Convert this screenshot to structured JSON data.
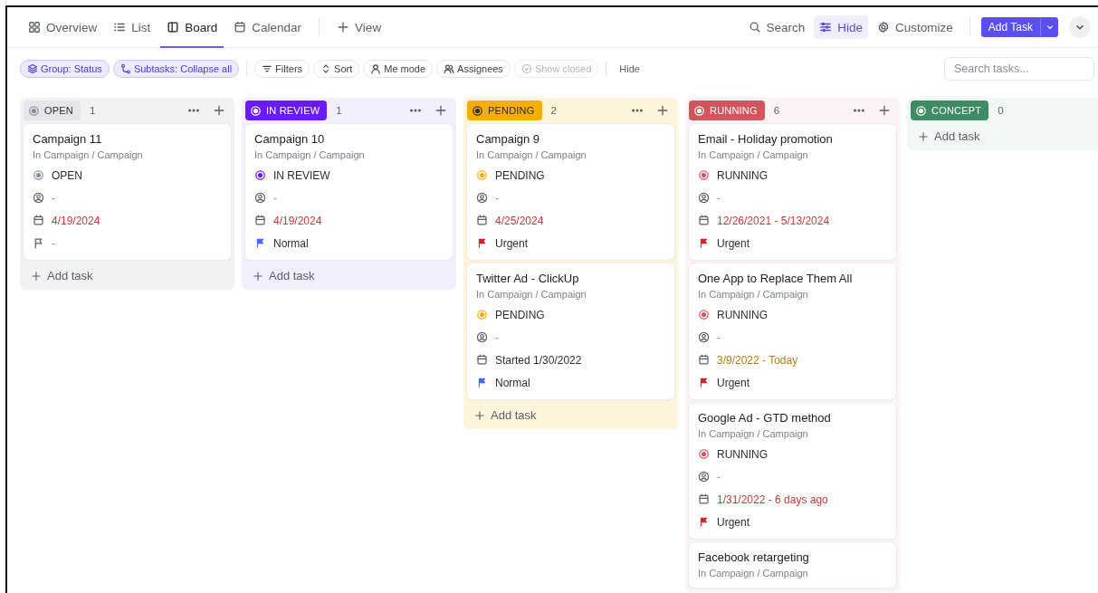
{
  "view_tabs": [
    {
      "label": "Overview",
      "selected": false
    },
    {
      "label": "List",
      "selected": false
    },
    {
      "label": "Board",
      "selected": true
    },
    {
      "label": "Calendar",
      "selected": false
    }
  ],
  "add_view": {
    "label": "View"
  },
  "header_actions": [
    {
      "label": "Search",
      "selected": false
    },
    {
      "label": "Hide",
      "selected": true
    },
    {
      "label": "Customize",
      "selected": false
    }
  ],
  "add_task_button": {
    "label": "Add Task"
  },
  "toolbar": {
    "chips": [
      {
        "label": "Group: Status",
        "active": true,
        "disabled": false
      },
      {
        "label": "Subtasks: Collapse all",
        "active": true,
        "disabled": false
      },
      {
        "label": "Filters",
        "active": false,
        "disabled": false
      },
      {
        "label": "Sort",
        "active": false,
        "disabled": false
      },
      {
        "label": "Me mode",
        "active": false,
        "disabled": false
      },
      {
        "label": "Assignees",
        "active": false,
        "disabled": false
      },
      {
        "label": "Show closed",
        "active": false,
        "disabled": true
      }
    ],
    "hide_label": "Hide",
    "search": {
      "placeholder": "Search tasks..."
    }
  },
  "columns": [
    {
      "status": "OPEN",
      "count": "1",
      "color": "#87909e",
      "kind": "soft",
      "add_icon": true,
      "add_task": "Add task",
      "cards": [
        {
          "title": "Campaign 11",
          "path": "In Campaign / Campaign",
          "status": "OPEN",
          "assignee": "-",
          "date": {
            "label": "4/19/2024",
            "color": "#c43b3b"
          },
          "priority": {
            "label": "-",
            "kind": "none"
          }
        }
      ]
    },
    {
      "status": "IN REVIEW",
      "count": "1",
      "color": "#6a1aff",
      "kind": "solid",
      "add_icon": true,
      "add_task": "Add task",
      "cards": [
        {
          "title": "Campaign 10",
          "path": "In Campaign / Campaign",
          "status": "IN REVIEW",
          "assignee": "-",
          "date": {
            "label": "4/19/2024",
            "color": "#c43b3b"
          },
          "priority": {
            "label": "Normal",
            "kind": "normal"
          }
        }
      ]
    },
    {
      "status": "PENDING",
      "count": "2",
      "color": "#f8ae00",
      "kind": "solid-dark",
      "add_icon": true,
      "add_task": "Add task",
      "cards": [
        {
          "title": "Campaign 9",
          "path": "In Campaign / Campaign",
          "status": "PENDING",
          "assignee": "-",
          "date": {
            "label": "4/25/2024",
            "color": "#c43b3b"
          },
          "priority": {
            "label": "Urgent",
            "kind": "urgent"
          }
        },
        {
          "title": "Twitter Ad - ClickUp",
          "path": "In Campaign / Campaign",
          "status": "PENDING",
          "assignee": "-",
          "date": {
            "label": "Started 1/30/2022",
            "color": "#2a2e34"
          },
          "priority": {
            "label": "Normal",
            "kind": "normal"
          }
        }
      ]
    },
    {
      "status": "RUNNING",
      "count": "6",
      "color": "#d1545e",
      "kind": "solid",
      "add_icon": true,
      "cards": [
        {
          "title": "Email - Holiday promotion",
          "path": "In Campaign / Campaign",
          "status": "RUNNING",
          "assignee": "-",
          "date": {
            "label": "12/26/2021 - 5/13/2024",
            "color": "#c43b3b"
          },
          "priority": {
            "label": "Urgent",
            "kind": "urgent"
          }
        },
        {
          "title": "One App to Replace Them All",
          "path": "In Campaign / Campaign",
          "status": "RUNNING",
          "assignee": "-",
          "date": {
            "label": "3/9/2022 - Today",
            "color": "#b07e12"
          },
          "priority": {
            "label": "Urgent",
            "kind": "urgent"
          }
        },
        {
          "title": "Google Ad - GTD method",
          "path": "In Campaign / Campaign",
          "status": "RUNNING",
          "assignee": "-",
          "date": {
            "label": "1/31/2022 - 6 days ago",
            "color": "#c43b3b"
          },
          "priority": {
            "label": "Urgent",
            "kind": "urgent"
          }
        },
        {
          "title": "Facebook retargeting",
          "path": "In Campaign / Campaign"
        }
      ]
    },
    {
      "status": "CONCEPT",
      "count": "0",
      "color": "#3f8b64",
      "kind": "solid",
      "add_icon": false,
      "add_task": "Add task"
    }
  ]
}
